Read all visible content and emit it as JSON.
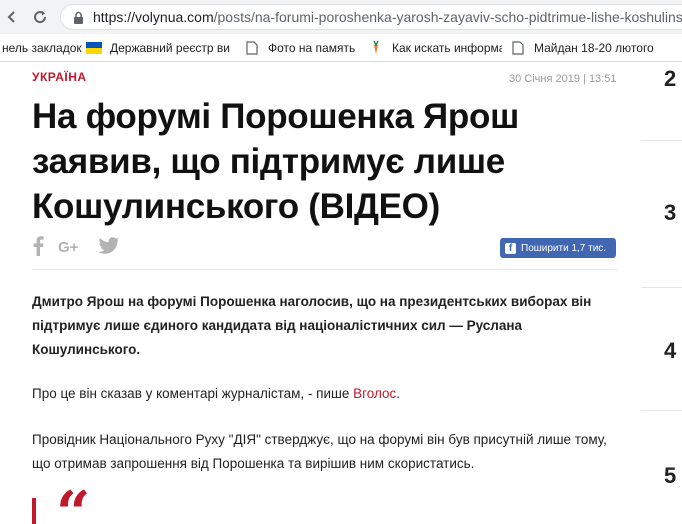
{
  "browser": {
    "url_host": "https://volynua.com",
    "url_path": "/posts/na-forumi-poroshenka-yarosh-zayaviv-scho-pidtrimue-lishe-koshulins",
    "bookmarks": [
      {
        "label": "нель закладок",
        "icon": "none"
      },
      {
        "label": "Державний реєстр ви",
        "icon": "ukraine-flag-icon"
      },
      {
        "label": "Фото на память",
        "icon": "page-icon"
      },
      {
        "label": "Как искать информац",
        "icon": "carrot-icon"
      },
      {
        "label": "Майдан 18-20 лютого",
        "icon": "page-icon"
      }
    ]
  },
  "article": {
    "category": "УКРАЇНА",
    "date": "30 Січня 2019 | 13:51",
    "title": "На форумі Порошенка Ярош заявив, що підтримує лише Кошулинського (ВІДЕО)",
    "share_label": "Поширити 1,7 тис.",
    "lead": "Дмитро Ярош на форумі Порошенка наголосив, що на президентських виборах він підтримує лише єдиного кандидата від націоналістичних сил — Руслана Кошулинського.",
    "p1_text": "Про це він сказав у коментарі журналістам, - пише ",
    "p1_link": "Вголос",
    "p1_end": ".",
    "p2": "Провідник Національного Руху \"ДІЯ\" стверджує, що на форумі він був присутній лише тому, що отримав запрошення від Порошенка та вирішив ним скористатись.",
    "quote_mark": "“"
  },
  "sidebar": {
    "numbers": [
      "2",
      "3",
      "4",
      "5"
    ]
  },
  "colors": {
    "accent": "#c2182b",
    "facebook": "#4267b2"
  }
}
